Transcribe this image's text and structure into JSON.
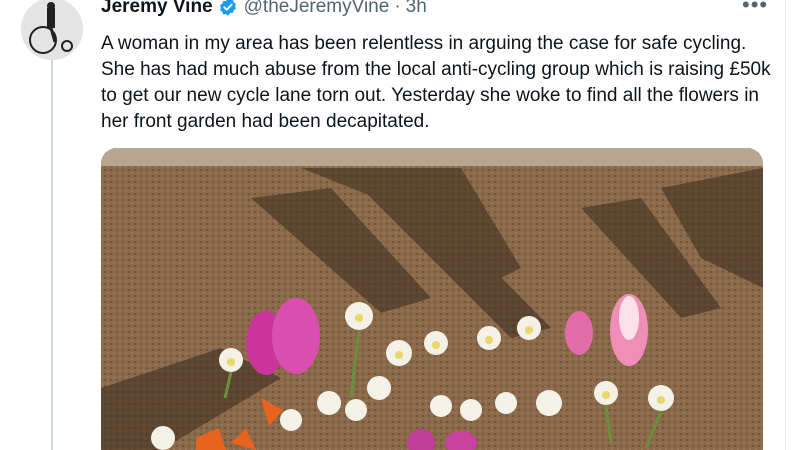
{
  "tweet": {
    "author_name": "Jeremy Vine",
    "handle": "@theJeremyVine",
    "separator": "·",
    "timestamp": "3h",
    "text": "A woman in my area has been relentless in arguing the case for safe cycling. She has had much abuse from the local anti-cycling group which is raising £50k to get our new cycle lane torn out. Yesterday she woke to find all the flowers in her front garden had been decapitated."
  },
  "icons": {
    "verified": "verified-badge-icon",
    "more": "more-options-icon"
  },
  "colors": {
    "verified_blue": "#1d9bf0",
    "secondary_text": "#536471",
    "thread_line": "#cfd9de"
  }
}
